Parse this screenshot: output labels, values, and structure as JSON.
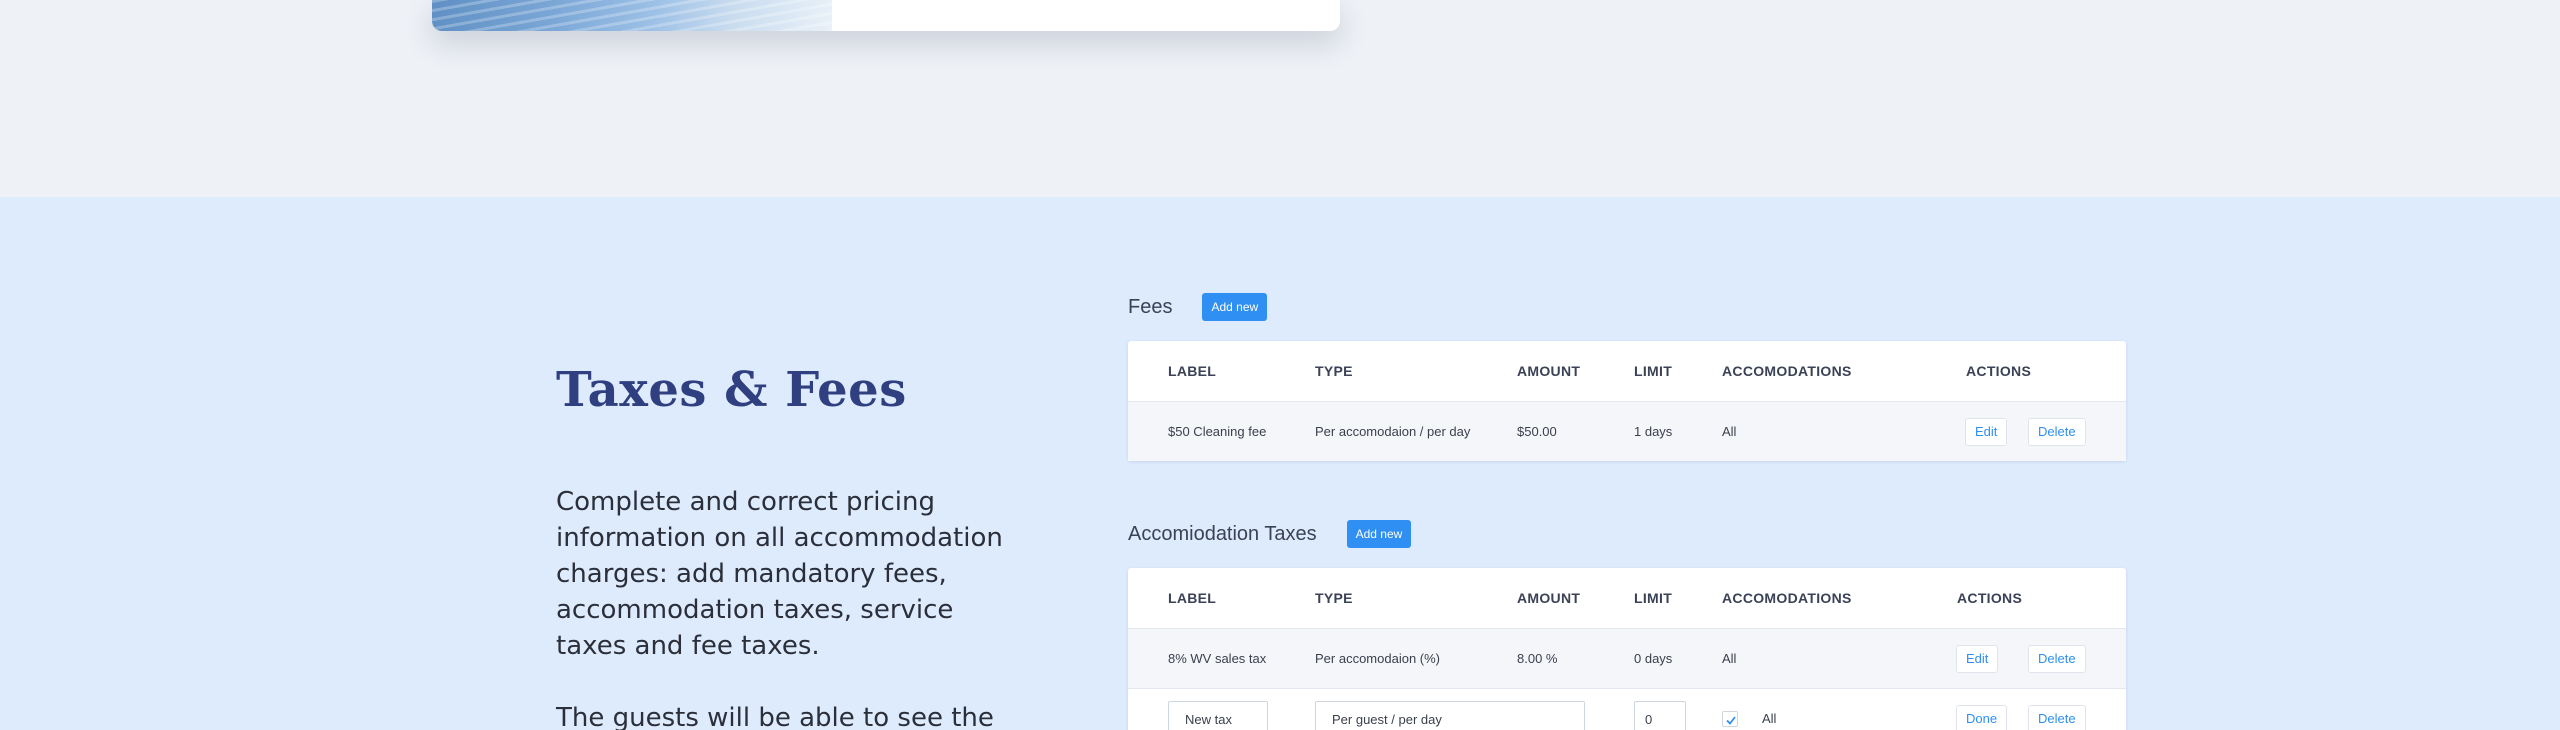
{
  "section": {
    "title": "Taxes & Fees",
    "description": "Complete and correct pricing information on all accommodation charges: add mandatory fees, accommodation taxes, service taxes and fee taxes.",
    "description2": "The guests will be able to see the"
  },
  "columns": {
    "label": "LABEL",
    "type": "TYPE",
    "amount": "AMOUNT",
    "limit": "LIMIT",
    "accomodations": "ACCOMODATIONS",
    "actions": "ACTIONS"
  },
  "fees": {
    "title": "Fees",
    "add_label": "Add new",
    "rows": [
      {
        "label": "$50 Cleaning fee",
        "type": "Per accomodaion / per day",
        "amount": "$50.00",
        "limit": "1 days",
        "accomodations": "All",
        "edit": "Edit",
        "delete": "Delete"
      }
    ]
  },
  "taxes": {
    "title": "Accomiodation Taxes",
    "add_label": "Add new",
    "rows": [
      {
        "label": "8% WV sales tax",
        "type": "Per accomodaion (%)",
        "amount": "8.00 %",
        "limit": "0 days",
        "accomodations": "All",
        "edit": "Edit",
        "delete": "Delete"
      }
    ],
    "edit_row": {
      "label_value": "New tax",
      "type_value": "Per guest / per day",
      "limit_value": "0",
      "all_checked": true,
      "accomodations": "All",
      "done": "Done",
      "delete": "Delete"
    }
  },
  "colors": {
    "accent": "#2f8ff3",
    "title": "#2f3f7f",
    "band": "#deebfd"
  }
}
